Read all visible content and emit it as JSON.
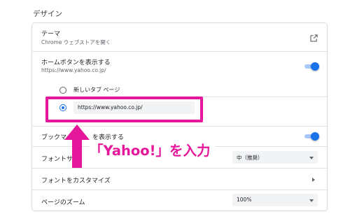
{
  "section_title": "デザイン",
  "theme": {
    "label": "テーマ",
    "sub": "Chrome ウェブストアを開く",
    "icon": "external-link-icon"
  },
  "home_button": {
    "label": "ホームボタンを表示する",
    "sub": "https://www.yahoo.co.jp/",
    "enabled": true,
    "options": {
      "new_tab_label": "新しいタブ ページ",
      "custom_url_value": "https://www.yahoo.co.jp/",
      "selected": "custom_url"
    }
  },
  "bookmarks_bar": {
    "label_visible": "ブックマー",
    "label_hidden_end": "を表示する",
    "enabled": true
  },
  "font_size": {
    "label_visible": "フォントサ",
    "value": "中（推奨）"
  },
  "customize_fonts": {
    "label": "フォントをカスタマイズ"
  },
  "page_zoom": {
    "label": "ページのズーム",
    "value": "100%"
  },
  "annotation": {
    "text": "「Yahoo!」を入力",
    "color": "#e5179a"
  },
  "colors": {
    "accent": "#1a73e8",
    "annotation": "#e5179a"
  }
}
